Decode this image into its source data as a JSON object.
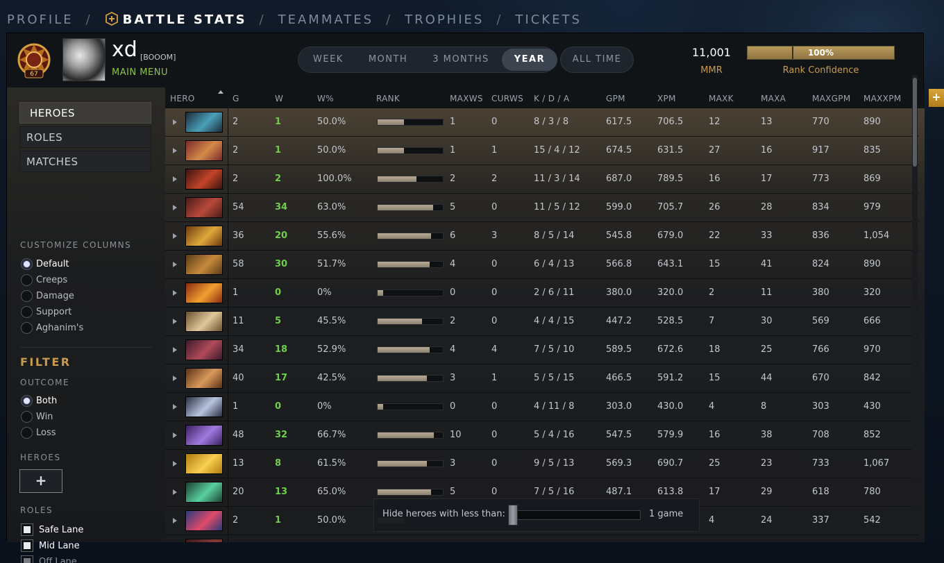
{
  "nav": {
    "items": [
      {
        "label": "PROFILE"
      },
      {
        "label": "BATTLE STATS",
        "active": true
      },
      {
        "label": "TEAMMATES"
      },
      {
        "label": "TROPHIES"
      },
      {
        "label": "TICKETS"
      }
    ],
    "separator": "/"
  },
  "header": {
    "rank_medal_level": "67",
    "player_name": "xd",
    "player_tag": "[BOOOM]",
    "main_menu_label": "MAIN MENU",
    "time_filters": [
      "WEEK",
      "MONTH",
      "3 MONTHS",
      "YEAR"
    ],
    "active_time_filter": "YEAR",
    "all_time_label": "ALL TIME",
    "mmr_value": "11,001",
    "mmr_label": "MMR",
    "rank_confidence_value": "100%",
    "rank_confidence_fraction": 1.0,
    "rank_confidence_label": "Rank Confidence"
  },
  "sidebar": {
    "tabs": [
      "HEROES",
      "ROLES",
      "MATCHES"
    ],
    "active_tab": "HEROES",
    "customize_heading": "CUSTOMIZE COLUMNS",
    "column_presets": [
      "Default",
      "Creeps",
      "Damage",
      "Support",
      "Aghanim's"
    ],
    "selected_preset": "Default",
    "filter_heading": "FILTER",
    "outcome_heading": "OUTCOME",
    "outcomes": [
      "Both",
      "Win",
      "Loss"
    ],
    "selected_outcome": "Both",
    "heroes_heading": "HEROES",
    "add_hero_symbol": "+",
    "roles_heading": "ROLES",
    "roles": [
      {
        "label": "Safe Lane",
        "checked": true
      },
      {
        "label": "Mid Lane",
        "checked": true
      },
      {
        "label": "Off Lane",
        "checked": true,
        "dim": true
      }
    ]
  },
  "table": {
    "columns": [
      "HERO",
      "G",
      "W",
      "W%",
      "RANK",
      "MAXWS",
      "CURWS",
      "K / D / A",
      "GPM",
      "XPM",
      "MAXK",
      "MAXA",
      "MAXGPM",
      "MAXXPM"
    ],
    "rows": [
      {
        "portrait": "dark hooded hero",
        "color_a": "#1b2a3a",
        "color_b": "#4aa0b8",
        "g": "2",
        "w": "1",
        "wp": "50.0%",
        "rank": 0.4,
        "maxws": "1",
        "curws": "0",
        "kda": "8 / 3 / 8",
        "gpm": "617.5",
        "xpm": "706.5",
        "maxk": "12",
        "maxa": "13",
        "maxgpm": "770",
        "maxxpm": "890"
      },
      {
        "portrait": "twin heads ogre",
        "color_a": "#7a2a2a",
        "color_b": "#d58a4a",
        "g": "2",
        "w": "1",
        "wp": "50.0%",
        "rank": 0.4,
        "maxws": "1",
        "curws": "1",
        "kda": "15 / 4 / 12",
        "gpm": "674.5",
        "xpm": "631.5",
        "maxk": "27",
        "maxa": "16",
        "maxgpm": "917",
        "maxxpm": "835"
      },
      {
        "portrait": "red horned demon",
        "color_a": "#3a1410",
        "color_b": "#c4442a",
        "g": "2",
        "w": "2",
        "wp": "100.0%",
        "rank": 0.6,
        "maxws": "2",
        "curws": "2",
        "kda": "11 / 3 / 14",
        "gpm": "687.0",
        "xpm": "789.5",
        "maxk": "16",
        "maxa": "17",
        "maxgpm": "773",
        "maxxpm": "869"
      },
      {
        "portrait": "axe warrior",
        "color_a": "#4a1a18",
        "color_b": "#b84a3a",
        "g": "54",
        "w": "34",
        "wp": "63.0%",
        "rank": 0.85,
        "maxws": "5",
        "curws": "0",
        "kda": "11 / 5 / 12",
        "gpm": "599.0",
        "xpm": "705.7",
        "maxk": "26",
        "maxa": "28",
        "maxgpm": "834",
        "maxxpm": "979"
      },
      {
        "portrait": "armored brawler",
        "color_a": "#6a3a10",
        "color_b": "#e0a83a",
        "g": "36",
        "w": "20",
        "wp": "55.6%",
        "rank": 0.82,
        "maxws": "6",
        "curws": "3",
        "kda": "8 / 5 / 14",
        "gpm": "545.8",
        "xpm": "679.0",
        "maxk": "22",
        "maxa": "33",
        "maxgpm": "836",
        "maxxpm": "1,054"
      },
      {
        "portrait": "bearded fighter",
        "color_a": "#5a3a18",
        "color_b": "#c48a3a",
        "g": "58",
        "w": "30",
        "wp": "51.7%",
        "rank": 0.8,
        "maxws": "4",
        "curws": "0",
        "kda": "6 / 4 / 13",
        "gpm": "566.8",
        "xpm": "643.1",
        "maxk": "15",
        "maxa": "41",
        "maxgpm": "824",
        "maxxpm": "890"
      },
      {
        "portrait": "fire beast",
        "color_a": "#8a2a10",
        "color_b": "#f0a030",
        "g": "1",
        "w": "0",
        "wp": "0%",
        "rank": 0.08,
        "maxws": "0",
        "curws": "0",
        "kda": "2 / 6 / 11",
        "gpm": "380.0",
        "xpm": "320.0",
        "maxk": "2",
        "maxa": "11",
        "maxgpm": "380",
        "maxxpm": "320"
      },
      {
        "portrait": "ram horned brute",
        "color_a": "#6a5030",
        "color_b": "#e0c89a",
        "g": "11",
        "w": "5",
        "wp": "45.5%",
        "rank": 0.68,
        "maxws": "2",
        "curws": "0",
        "kda": "4 / 4 / 15",
        "gpm": "447.2",
        "xpm": "528.5",
        "maxk": "7",
        "maxa": "30",
        "maxgpm": "569",
        "maxxpm": "666"
      },
      {
        "portrait": "flesh golem",
        "color_a": "#3a1a2a",
        "color_b": "#b04a5a",
        "g": "34",
        "w": "18",
        "wp": "52.9%",
        "rank": 0.8,
        "maxws": "4",
        "curws": "4",
        "kda": "7 / 5 / 10",
        "gpm": "589.5",
        "xpm": "672.6",
        "maxk": "18",
        "maxa": "25",
        "maxgpm": "766",
        "maxxpm": "970"
      },
      {
        "portrait": "tusked beast",
        "color_a": "#5a3018",
        "color_b": "#d89a5a",
        "g": "40",
        "w": "17",
        "wp": "42.5%",
        "rank": 0.76,
        "maxws": "3",
        "curws": "1",
        "kda": "5 / 5 / 15",
        "gpm": "466.5",
        "xpm": "591.2",
        "maxk": "15",
        "maxa": "44",
        "maxgpm": "670",
        "maxxpm": "842"
      },
      {
        "portrait": "frost knight",
        "color_a": "#2a3040",
        "color_b": "#b8c4e0",
        "g": "1",
        "w": "0",
        "wp": "0%",
        "rank": 0.08,
        "maxws": "0",
        "curws": "0",
        "kda": "4 / 11 / 8",
        "gpm": "303.0",
        "xpm": "430.0",
        "maxk": "4",
        "maxa": "8",
        "maxgpm": "303",
        "maxxpm": "430"
      },
      {
        "portrait": "purple mage",
        "color_a": "#3a2060",
        "color_b": "#a07ae0",
        "g": "48",
        "w": "32",
        "wp": "66.7%",
        "rank": 0.86,
        "maxws": "10",
        "curws": "0",
        "kda": "5 / 4 / 16",
        "gpm": "547.5",
        "xpm": "579.9",
        "maxk": "16",
        "maxa": "38",
        "maxgpm": "708",
        "maxxpm": "852"
      },
      {
        "portrait": "golden monkey",
        "color_a": "#b07a10",
        "color_b": "#f8d050",
        "g": "13",
        "w": "8",
        "wp": "61.5%",
        "rank": 0.76,
        "maxws": "3",
        "curws": "0",
        "kda": "9 / 5 / 13",
        "gpm": "569.3",
        "xpm": "690.7",
        "maxk": "25",
        "maxa": "23",
        "maxgpm": "733",
        "maxxpm": "1,067"
      },
      {
        "portrait": "green hooded",
        "color_a": "#1a4030",
        "color_b": "#5ad0a0",
        "g": "20",
        "w": "13",
        "wp": "65.0%",
        "rank": 0.82,
        "maxws": "5",
        "curws": "0",
        "kda": "7 / 5 / 16",
        "gpm": "487.1",
        "xpm": "613.8",
        "maxk": "17",
        "maxa": "29",
        "maxgpm": "618",
        "maxxpm": "780"
      },
      {
        "portrait": "blue red spirit",
        "color_a": "#2a3a7a",
        "color_b": "#e04a6a",
        "g": "2",
        "w": "1",
        "wp": "50.0%",
        "rank": 0.4,
        "maxws": "",
        "curws": "",
        "kda": "",
        "gpm": "",
        "xpm": "",
        "maxk": "4",
        "maxa": "24",
        "maxgpm": "337",
        "maxxpm": "542"
      },
      {
        "portrait": "partial next hero",
        "color_a": "#3a1818",
        "color_b": "#8a3a3a",
        "g": "",
        "w": "",
        "wp": "",
        "rank": 0,
        "maxws": "",
        "curws": "",
        "kda": "",
        "gpm": "",
        "xpm": "",
        "maxk": "",
        "maxa": "",
        "maxgpm": "",
        "maxxpm": ""
      }
    ]
  },
  "hide_filter": {
    "label": "Hide heroes with less than:",
    "value": "1 game"
  },
  "corner_plus": "+"
}
